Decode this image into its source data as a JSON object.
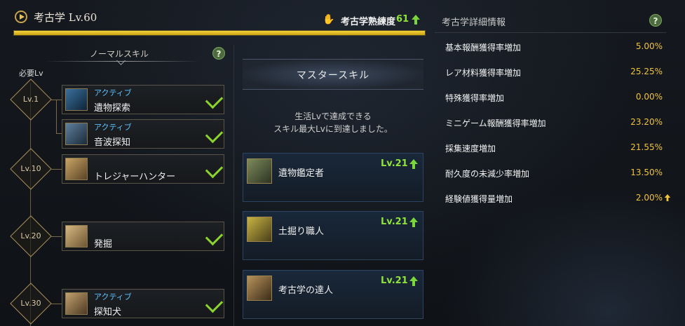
{
  "header": {
    "title": "考古学 Lv.60",
    "mastery_label": "考古学熟練度",
    "mastery_value": "61",
    "progress_fraction": 1.0
  },
  "normal_skills": {
    "heading": "ノーマルスキル",
    "required_lv_label": "必要Lv",
    "levels": [
      "Lv.1",
      "Lv.10",
      "Lv.20",
      "Lv.30"
    ],
    "items": [
      {
        "type": "アクティブ",
        "name": "遺物探索",
        "icon": "relic-search-icon"
      },
      {
        "type": "アクティブ",
        "name": "音波探知",
        "icon": "sonar-icon"
      },
      {
        "type": "",
        "name": "トレジャーハンター",
        "icon": "treasure-icon"
      },
      {
        "type": "",
        "name": "発掘",
        "icon": "excavation-icon"
      },
      {
        "type": "アクティブ",
        "name": "探知犬",
        "icon": "detection-dog-icon"
      }
    ]
  },
  "master_skills": {
    "heading": "マスタースキル",
    "message_line1": "生活Lvで達成できる",
    "message_line2": "スキル最大Lvに到達しました。",
    "items": [
      {
        "name": "遺物鑑定者",
        "lv": "Lv.21",
        "icon": "appraiser-icon"
      },
      {
        "name": "土掘り職人",
        "lv": "Lv.21",
        "icon": "digger-icon"
      },
      {
        "name": "考古学の達人",
        "lv": "Lv.21",
        "icon": "archaeology-master-icon"
      }
    ]
  },
  "details": {
    "heading": "考古学詳細情報",
    "stats": [
      {
        "label": "基本報酬獲得率増加",
        "value": "5.00%"
      },
      {
        "label": "レア材料獲得率増加",
        "value": "25.25%"
      },
      {
        "label": "特殊獲得率増加",
        "value": "0.00%"
      },
      {
        "label": "ミニゲーム報酬獲得率増加",
        "value": "23.20%"
      },
      {
        "label": "採集速度増加",
        "value": "21.55%"
      },
      {
        "label": "耐久度の未減少率増加",
        "value": "13.50%"
      },
      {
        "label": "経験値獲得量増加",
        "value": "2.00%"
      }
    ]
  },
  "colors": {
    "accent_gold": "#f0c33c",
    "active_blue": "#5ec2ff",
    "check_green": "#8cd32e",
    "level_green": "#8fe33a"
  }
}
